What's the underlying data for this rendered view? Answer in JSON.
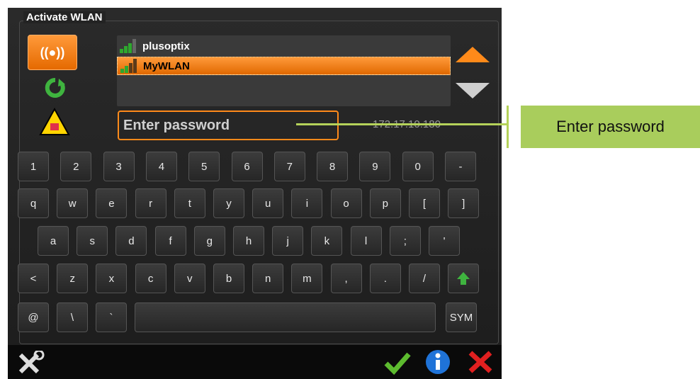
{
  "title": "Activate WLAN",
  "networks": [
    {
      "name": "plusoptix",
      "selected": false
    },
    {
      "name": "MyWLAN",
      "selected": true
    }
  ],
  "password": {
    "placeholder": "Enter password"
  },
  "ip": "172.17.10.180",
  "keyboard": {
    "row1": [
      "1",
      "2",
      "3",
      "4",
      "5",
      "6",
      "7",
      "8",
      "9",
      "0",
      "-"
    ],
    "row2": [
      "q",
      "w",
      "e",
      "r",
      "t",
      "y",
      "u",
      "i",
      "o",
      "p",
      "[",
      "]"
    ],
    "row3": [
      "a",
      "s",
      "d",
      "f",
      "g",
      "h",
      "j",
      "k",
      "l",
      ";",
      "'"
    ],
    "row4": [
      "<",
      "z",
      "x",
      "c",
      "v",
      "b",
      "n",
      "m",
      ",",
      ".",
      "/"
    ],
    "row5": [
      "@",
      "\\",
      "`",
      "",
      "SYM"
    ]
  },
  "callout": {
    "label": "Enter password"
  },
  "colors": {
    "accent": "#ff8a1a",
    "callout": "#a9cd5c"
  },
  "icons": {
    "wifi": "wifi-icon",
    "refresh": "refresh-icon",
    "warning": "warning-icon",
    "shift": "shift-icon",
    "tools": "tools-icon",
    "ok": "check-icon",
    "info": "info-icon",
    "cancel": "close-icon"
  }
}
